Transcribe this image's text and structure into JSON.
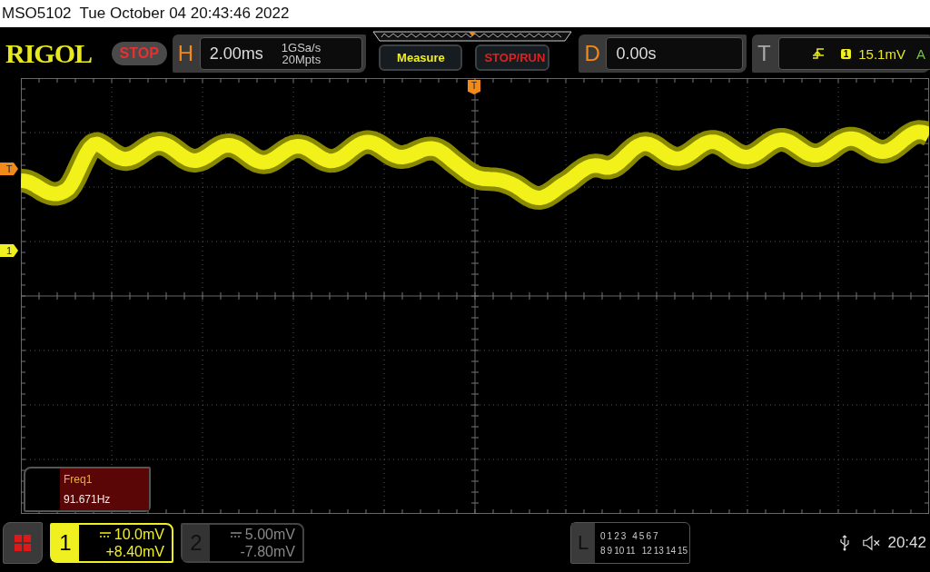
{
  "title_bar": {
    "model": "MSO5102",
    "datetime": "Tue October 04 20:43:46 2022"
  },
  "toolbar": {
    "logo": "RIGOL",
    "run_state": {
      "label": "STOP",
      "kind": "stop"
    },
    "horizontal": {
      "key": "H",
      "timebase": "2.00ms",
      "sample_rate": "1GSa/s",
      "memory_depth": "20Mpts"
    },
    "buttons": [
      {
        "label": "Measure",
        "kind": "measure"
      },
      {
        "label": "STOP/RUN",
        "kind": "stoprun"
      }
    ],
    "delay": {
      "key": "D",
      "value": "0.00s"
    },
    "trigger": {
      "key": "T",
      "channel": "1",
      "level": "15.1mV",
      "mode": "A"
    }
  },
  "screen": {
    "markers": [
      {
        "label": "T",
        "kind": "trigger_position"
      },
      {
        "label": "T",
        "kind": "trigger_level"
      },
      {
        "label": "1",
        "kind": "channel"
      }
    ],
    "measurement": {
      "name": "Freq1",
      "value": "91.671Hz"
    }
  },
  "bottom_bar": {
    "channels": [
      {
        "number": "1",
        "scale": "10.0mV",
        "offset": "+8.40mV",
        "selected": true
      },
      {
        "number": "2",
        "scale": "5.00mV",
        "offset": "-7.80mV",
        "selected": false
      }
    ],
    "logic": {
      "key": "L",
      "row_1": [
        "0",
        "1",
        "2",
        "3",
        "4",
        "5",
        "6",
        "7"
      ],
      "row_2": [
        "8",
        "9",
        "10",
        "11",
        "12",
        "13",
        "14",
        "15"
      ]
    },
    "clock": "20:42"
  }
}
